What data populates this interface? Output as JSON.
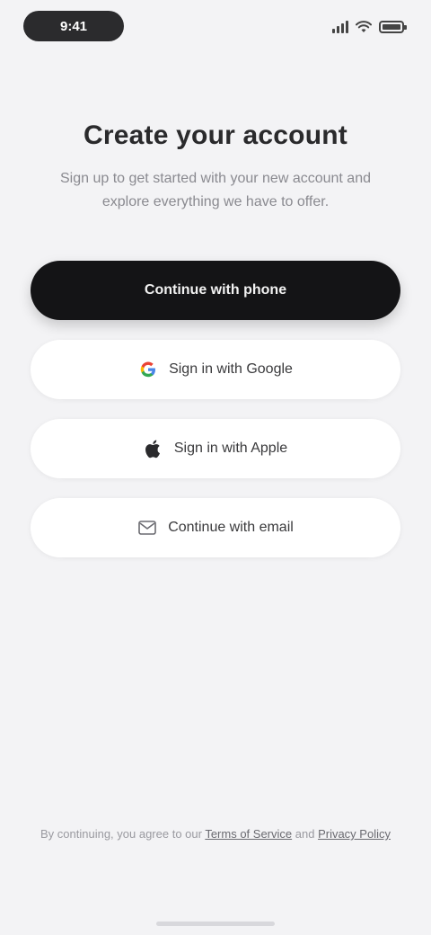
{
  "status_bar": {
    "time": "9:41",
    "icons": [
      "signal-icon",
      "wifi-icon",
      "battery-icon"
    ]
  },
  "header": {
    "title": "Create your account",
    "subtitle": "Sign up to get started with your new account and explore everything we have to offer."
  },
  "actions": {
    "primary_label": "Continue with phone",
    "google_label": "Sign in with Google",
    "apple_label": "Sign in with Apple",
    "email_label": "Continue with email"
  },
  "footer": {
    "prefix": "By continuing, you agree to our ",
    "terms_label": "Terms of Service",
    "joiner": " and ",
    "privacy_label": "Privacy Policy"
  },
  "colors": {
    "background": "#f3f3f5",
    "primary_button": "#141416",
    "secondary_button": "#ffffff",
    "title_text": "#2a2a2c",
    "muted_text": "#8a8a90"
  }
}
